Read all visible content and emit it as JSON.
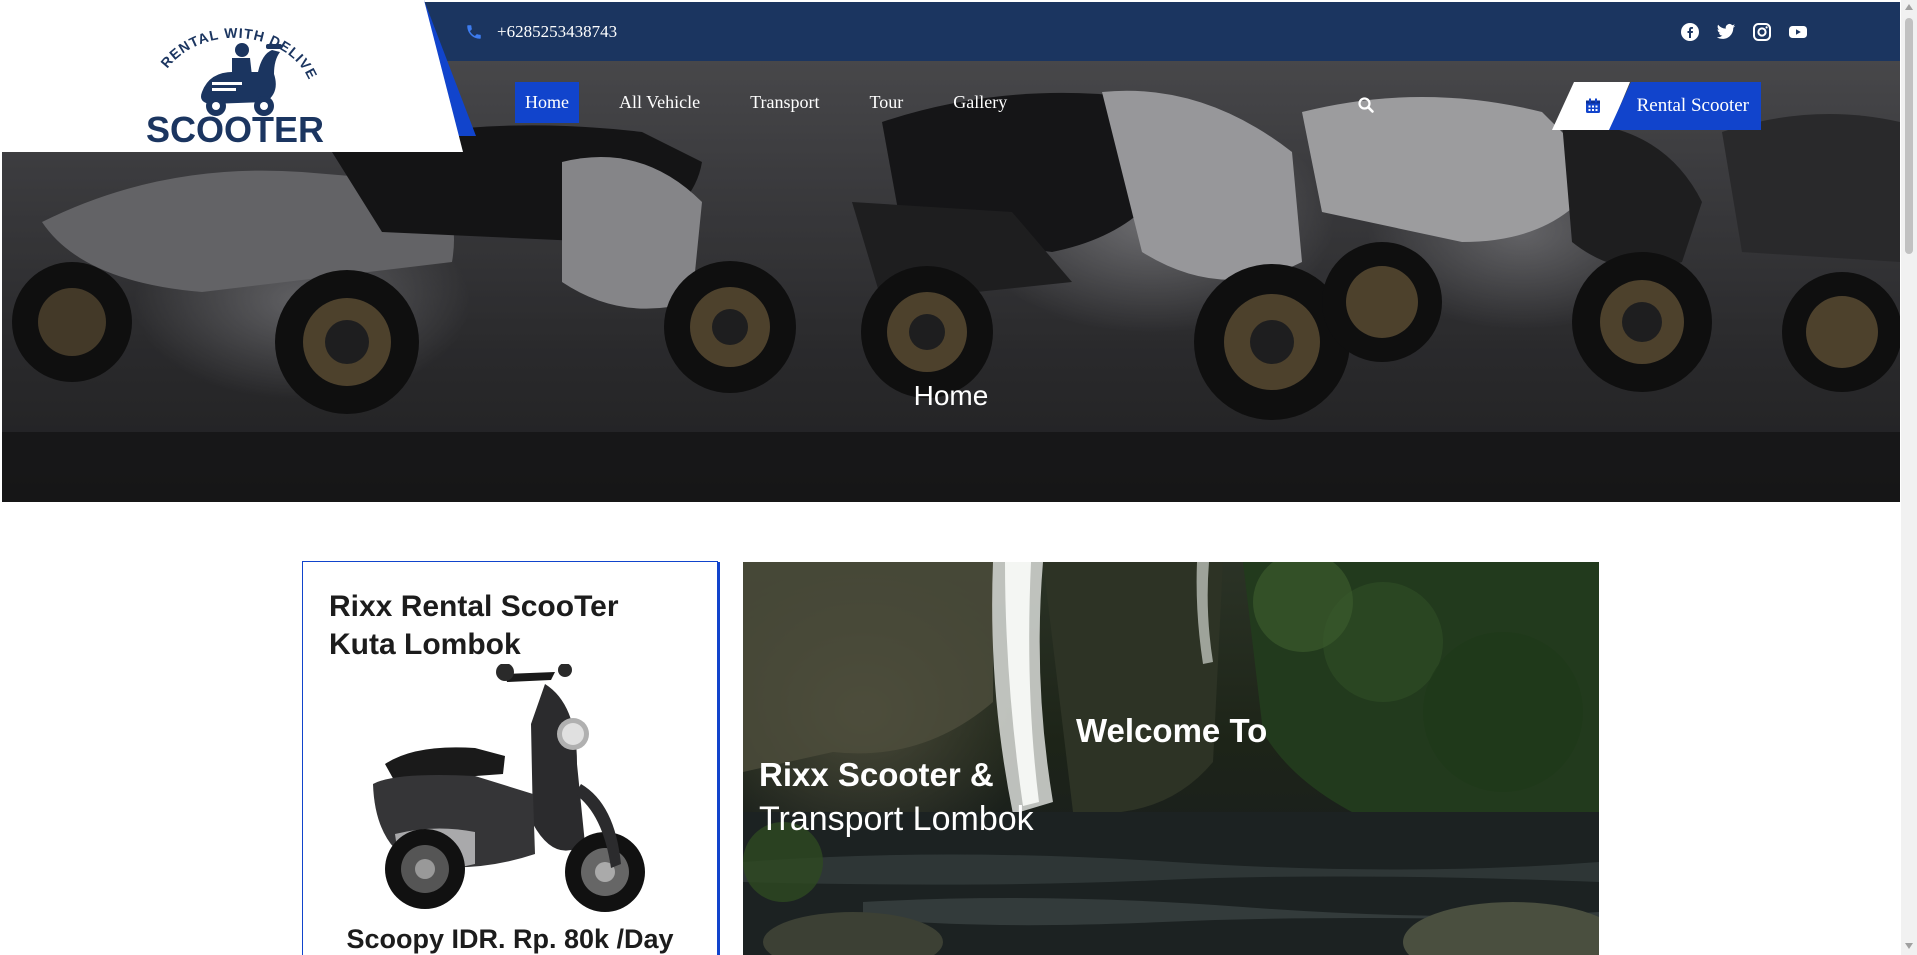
{
  "logo": {
    "arc_text": "RENTAL WITH DELIVERY",
    "wordmark": "SCOOTER",
    "icon": "scooter-logo-icon"
  },
  "topbar": {
    "phone": "+6285253438743",
    "phone_icon": "phone-icon",
    "socials": [
      {
        "name": "facebook-icon"
      },
      {
        "name": "twitter-icon"
      },
      {
        "name": "instagram-icon"
      },
      {
        "name": "youtube-icon"
      }
    ]
  },
  "nav": {
    "items": [
      {
        "label": "Home",
        "active": true
      },
      {
        "label": "All Vehicle",
        "active": false
      },
      {
        "label": "Transport",
        "active": false
      },
      {
        "label": "Tour",
        "active": false
      },
      {
        "label": "Gallery",
        "active": false
      }
    ],
    "search_icon": "search-icon",
    "cta_label": "Rental Scooter",
    "cta_icon": "calendar-icon"
  },
  "hero": {
    "title": "Home"
  },
  "card": {
    "title": "Rixx Rental ScooTer Kuta Lombok",
    "price": "Scoopy IDR. Rp. 80k /Day"
  },
  "welcome": {
    "heading": "Welcome To",
    "name": "Rixx Scooter &",
    "subtitle": "Transport Lombok"
  },
  "colors": {
    "navy": "#1b3560",
    "accent_blue": "#1144cc",
    "white": "#ffffff",
    "text_dark": "#1c1c1c"
  }
}
